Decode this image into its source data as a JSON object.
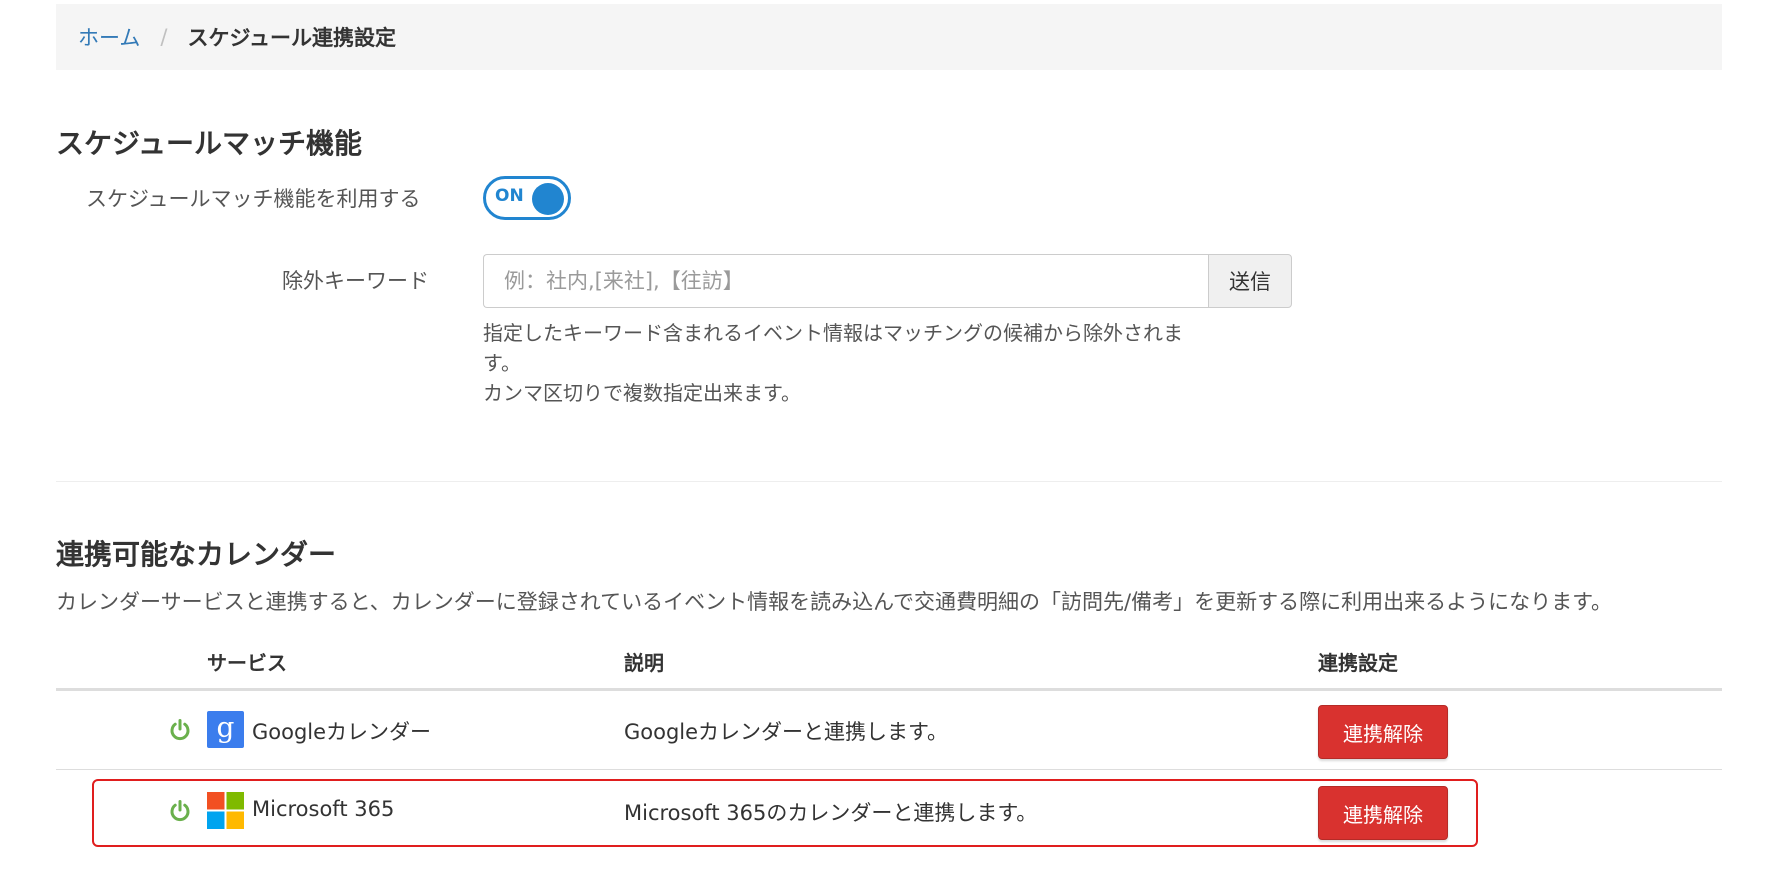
{
  "breadcrumb": {
    "home": "ホーム",
    "separator": "/",
    "current": "スケジュール連携設定"
  },
  "schedule_match": {
    "title": "スケジュールマッチ機能",
    "toggle_label": "スケジュールマッチ機能を利用する",
    "toggle_state": "ON",
    "keyword_label": "除外キーワード",
    "keyword_value": "",
    "keyword_placeholder": "例：社内,[来社],【往訪】",
    "send_label": "送信",
    "help_line1": "指定したキーワード含まれるイベント情報はマッチングの候補から除外されま",
    "help_line2": "す。",
    "help_line3": "カンマ区切りで複数指定出来ます。"
  },
  "calendars": {
    "title": "連携可能なカレンダー",
    "description": "カレンダーサービスと連携すると、カレンダーに登録されているイベント情報を読み込んで交通費明細の「訪問先/備考」を更新する際に利用出来るようになります。",
    "headers": {
      "service": "サービス",
      "description": "説明",
      "settings": "連携設定"
    },
    "rows": [
      {
        "status_icon": "power-icon",
        "logo": "google-logo",
        "service": "Googleカレンダー",
        "description": "Googleカレンダーと連携します。",
        "action": "連携解除"
      },
      {
        "status_icon": "power-icon",
        "logo": "microsoft-logo",
        "service": "Microsoft 365",
        "description": "Microsoft 365のカレンダーと連携します。",
        "action": "連携解除"
      }
    ]
  },
  "colors": {
    "link": "#337ab7",
    "toggle_accent": "#2185d0",
    "status_on": "#6ab04c",
    "danger_button": "#d9322f",
    "highlight": "#e01e1e"
  }
}
